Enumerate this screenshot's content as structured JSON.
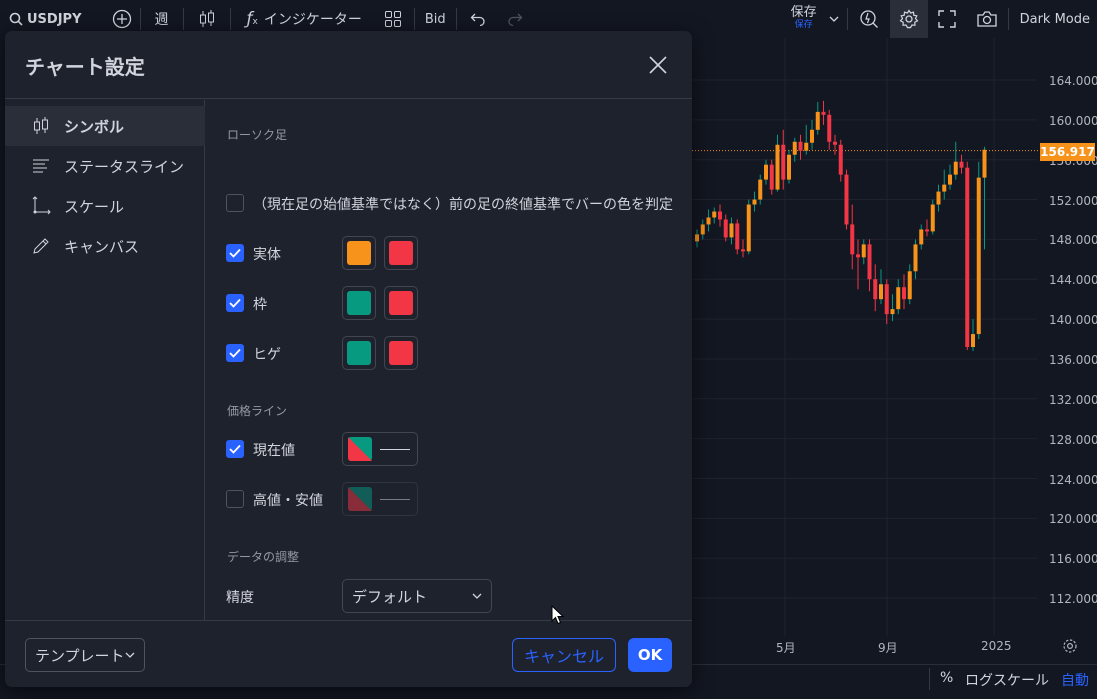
{
  "toolbar": {
    "symbol": "USDJPY",
    "interval": "週",
    "indicators_label": "インジケーター",
    "price_type": "Bid",
    "save_label": "保存",
    "save_sub": "保存",
    "theme_label": "Dark Mode"
  },
  "chart": {
    "price_ticks": [
      "164.000",
      "160.000",
      "156.000",
      "152.000",
      "148.000",
      "144.000",
      "140.000",
      "136.000",
      "132.000",
      "128.000",
      "124.000",
      "120.000",
      "116.000",
      "112.000"
    ],
    "current_price": "156.917",
    "time_ticks": [
      "5月",
      "9月",
      "2025"
    ],
    "bottom": {
      "percent_label": "%",
      "log_label": "ログスケール",
      "auto_label": "自動"
    },
    "colors": {
      "up": "#f7931a",
      "down": "#f23645",
      "price_line": "#f7931a"
    }
  },
  "dialog": {
    "title": "チャート設定",
    "sidebar": [
      {
        "label": "シンボル",
        "icon": "candles-icon",
        "active": true
      },
      {
        "label": "ステータスライン",
        "icon": "status-line-icon",
        "active": false
      },
      {
        "label": "スケール",
        "icon": "scale-icon",
        "active": false
      },
      {
        "label": "キャンバス",
        "icon": "pencil-icon",
        "active": false
      }
    ],
    "sections": {
      "candles": "ローソク足",
      "price_lines": "価格ライン",
      "data_adjust": "データの調整"
    },
    "rows": {
      "prev_close": {
        "label": "（現在足の始値基準ではなく）前の足の終値基準でバーの色を判定",
        "checked": false
      },
      "body": {
        "label": "実体",
        "checked": true,
        "colors": [
          "#f7931a",
          "#f23645"
        ]
      },
      "border": {
        "label": "枠",
        "checked": true,
        "colors": [
          "#089981",
          "#f23645"
        ]
      },
      "wick": {
        "label": "ヒゲ",
        "checked": true,
        "colors": [
          "#089981",
          "#f23645"
        ]
      },
      "current_value": {
        "label": "現在値",
        "checked": true
      },
      "high_low": {
        "label": "高値・安値",
        "checked": false
      }
    },
    "precision": {
      "label": "精度",
      "value": "デフォルト"
    },
    "footer": {
      "template": "テンプレート",
      "cancel": "キャンセル",
      "ok": "OK"
    }
  }
}
